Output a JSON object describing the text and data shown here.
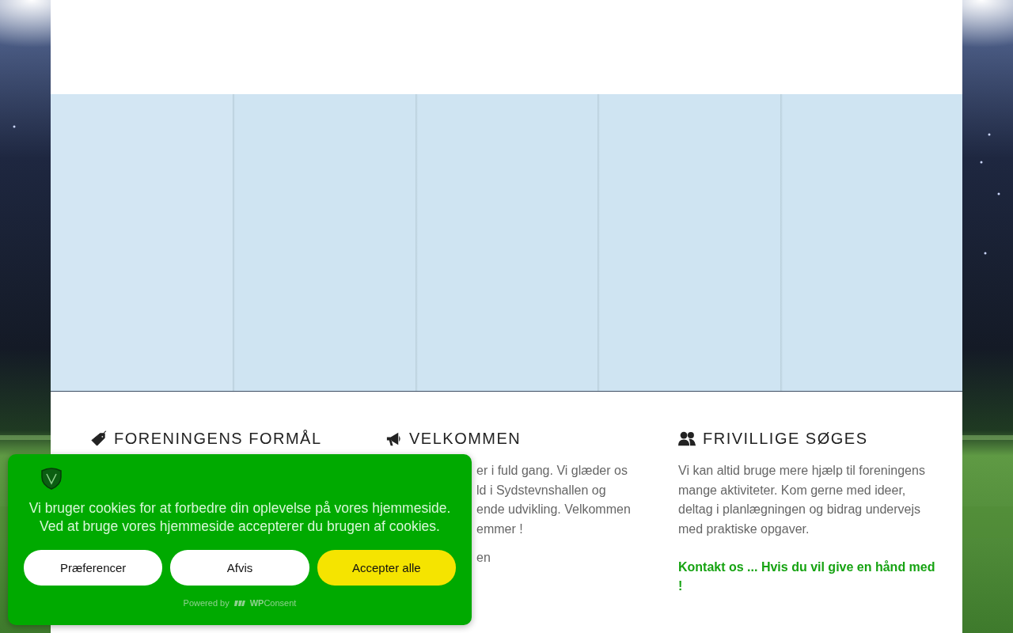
{
  "sections": [
    {
      "kind": "tag",
      "title": "FORENINGENS FORMÅL"
    },
    {
      "kind": "megaphone",
      "title": "VELKOMMEN",
      "lines": [
        "er i fuld gang. Vi glæder os",
        "ld i Sydstevnshallen og",
        "ende udvikling. Velkommen",
        "emmer !"
      ],
      "note": "en"
    },
    {
      "kind": "people",
      "title": "FRIVILLIGE SØGES",
      "text": "Vi kan altid bruge mere hjælp til foreningens mange aktiviteter. Kom gerne med ideer, deltag i planlægningen og bidrag undervejs med praktiske opgaver.",
      "link": "Kontakt os ... Hvis du vil give en hånd med !"
    }
  ],
  "cookie_banner": {
    "message": "Vi bruger cookies for at forbedre din oplevelse på vores hjemmeside. Ved at bruge vores hjemmeside accepterer du brugen af cookies.",
    "buttons": [
      {
        "label": "Præferencer",
        "kind": "secondary"
      },
      {
        "label": "Afvis",
        "kind": "secondary"
      },
      {
        "label": "Accepter alle",
        "kind": "primary"
      }
    ],
    "powered_by": "Powered by",
    "brand": "**WP**Consent"
  }
}
